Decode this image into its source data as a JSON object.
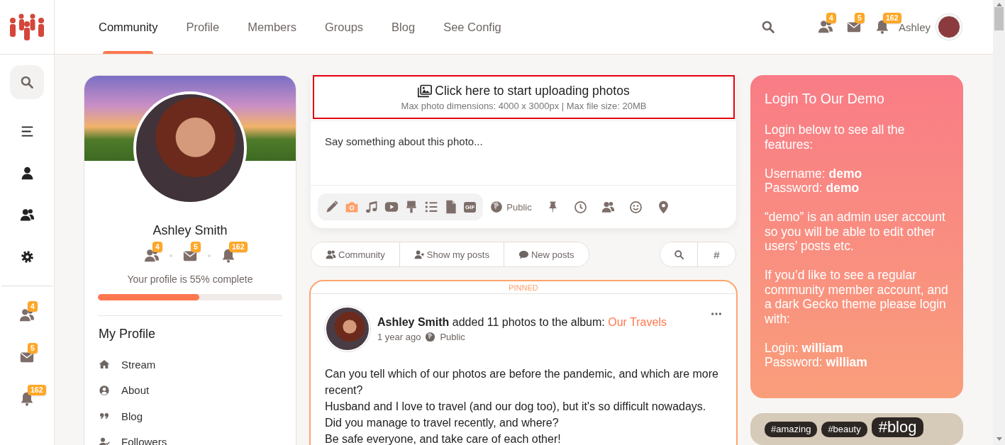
{
  "nav": [
    {
      "label": "Community",
      "selected": true
    },
    {
      "label": "Profile",
      "selected": false
    },
    {
      "label": "Members",
      "selected": false
    },
    {
      "label": "Groups",
      "selected": false
    },
    {
      "label": "Blog",
      "selected": false
    },
    {
      "label": "See Config",
      "selected": false
    }
  ],
  "header": {
    "user_name": "Ashley",
    "badges": [
      {
        "kind": "friends",
        "count": "4"
      },
      {
        "kind": "messages",
        "count": "5"
      },
      {
        "kind": "notifications",
        "count": "162"
      }
    ]
  },
  "rail": {
    "items": [
      {
        "kind": "menu"
      },
      {
        "kind": "user"
      },
      {
        "kind": "users"
      },
      {
        "kind": "settings"
      }
    ],
    "badges": [
      {
        "kind": "friends",
        "count": "4"
      },
      {
        "kind": "messages",
        "count": "5"
      },
      {
        "kind": "notifications",
        "count": "162"
      }
    ]
  },
  "profile": {
    "name": "Ashley Smith",
    "badges": [
      {
        "kind": "friends",
        "count": "4"
      },
      {
        "kind": "messages",
        "count": "5"
      },
      {
        "kind": "notifications",
        "count": "162"
      }
    ],
    "completion_text": "Your profile is 55% complete",
    "level": 0.55,
    "menu_title": "My Profile",
    "menu": [
      {
        "kind": "home",
        "label": "Stream"
      },
      {
        "kind": "user-circle",
        "label": "About"
      },
      {
        "kind": "quote",
        "label": "Blog"
      },
      {
        "kind": "user-check",
        "label": "Followers"
      }
    ]
  },
  "composer": {
    "upload_title": "Click here to start uploading photos",
    "upload_hint": "Max photo dimensions: 4000 x 3000px | Max file size: 20MB",
    "placeholder": "Say something about this photo...",
    "tools": [
      {
        "kind": "pencil",
        "selected": false
      },
      {
        "kind": "camera",
        "selected": true
      },
      {
        "kind": "music",
        "selected": false
      },
      {
        "kind": "video",
        "selected": false
      },
      {
        "kind": "brush",
        "selected": false
      },
      {
        "kind": "list",
        "selected": false
      },
      {
        "kind": "file",
        "selected": false
      },
      {
        "kind": "gif",
        "label": "GIF",
        "selected": false
      }
    ],
    "privacy": "Public",
    "actions": [
      {
        "kind": "pin"
      },
      {
        "kind": "clock"
      },
      {
        "kind": "users"
      },
      {
        "kind": "smile"
      },
      {
        "kind": "marker"
      }
    ]
  },
  "filters": [
    {
      "kind": "users",
      "label": "Community"
    },
    {
      "kind": "user-plus",
      "label": "Show my posts"
    },
    {
      "kind": "comment",
      "label": "New posts"
    }
  ],
  "filter_tools": [
    {
      "kind": "search"
    },
    {
      "kind": "hash",
      "label": "#"
    }
  ],
  "post": {
    "pinned_label": "PINNED",
    "author": "Ashley Smith",
    "action": "added 11 photos to the album:",
    "album": "Our Travels",
    "time": "1 year ago",
    "privacy": "Public",
    "lines": [
      "Can you tell which of our photos are before the pandemic, and which are more recent?",
      "Husband and I love to travel (and our dog too), but it's so difficult nowadays.",
      "Did you manage to travel recently, and where?",
      "Be safe everyone, and take care of each other!"
    ]
  },
  "login_card": {
    "title": "Login To Our Demo",
    "paragraphs": [
      "Login below to see all the features:",
      "Username: **demo**\nPassword: **demo**",
      "“demo” is an admin user account so you will be able to edit other users’ posts etc.",
      "If you’d like to see a regular community member account, and a dark Gecko theme please login with:",
      "Login: **william**\nPassword: **william**"
    ]
  },
  "tags": [
    {
      "label": "#amazing",
      "kind": "small"
    },
    {
      "label": "#beauty",
      "kind": "small"
    },
    {
      "label": "#blog",
      "kind": "large"
    }
  ]
}
